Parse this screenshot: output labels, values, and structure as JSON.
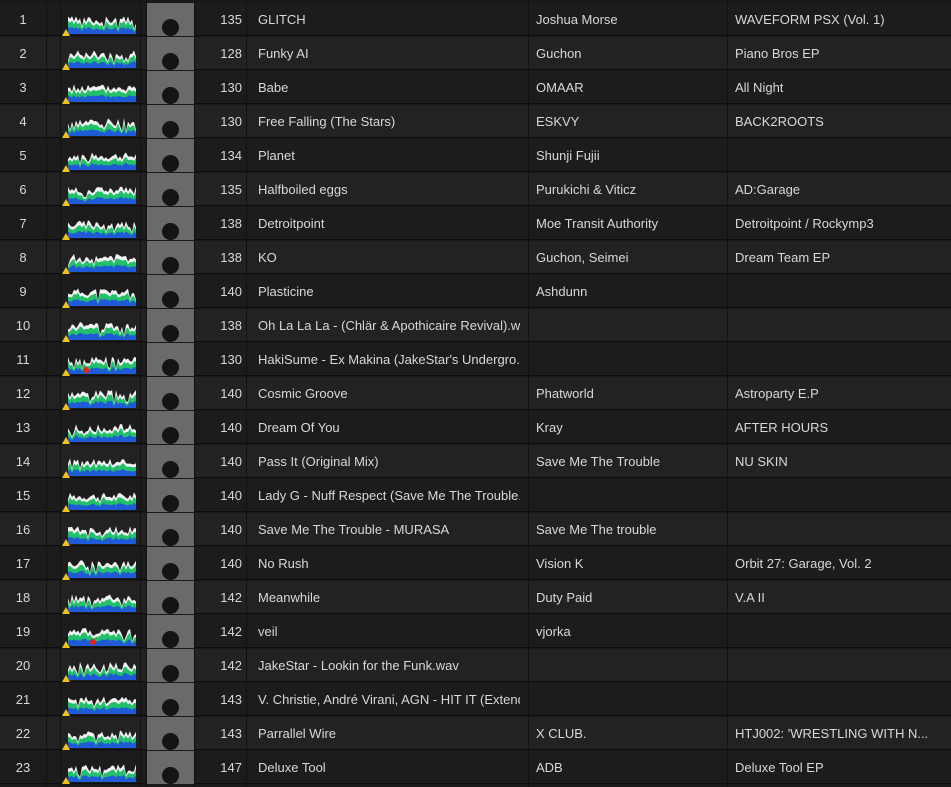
{
  "colors": {
    "waveform_bass": "#1f5bd6",
    "waveform_mid": "#23c06a",
    "waveform_high": "#f2f2f2",
    "cue_marker": "#f1c21a",
    "hot_cue_marker": "#e0261f"
  },
  "tracks": [
    {
      "num": "1",
      "bpm": "135",
      "title": "GLITCH",
      "artist": "Joshua Morse",
      "album": "WAVEFORM PSX (Vol. 1)"
    },
    {
      "num": "2",
      "bpm": "128",
      "title": "Funky AI",
      "artist": "Guchon",
      "album": "Piano Bros EP"
    },
    {
      "num": "3",
      "bpm": "130",
      "title": "Babe",
      "artist": "OMAAR",
      "album": "All Night"
    },
    {
      "num": "4",
      "bpm": "130",
      "title": "Free Falling (The Stars)",
      "artist": "ESKVY",
      "album": "BACK2ROOTS"
    },
    {
      "num": "5",
      "bpm": "134",
      "title": "Planet",
      "artist": "Shunji Fujii",
      "album": ""
    },
    {
      "num": "6",
      "bpm": "135",
      "title": "Halfboiled eggs",
      "artist": "Purukichi & Viticz",
      "album": "AD:Garage"
    },
    {
      "num": "7",
      "bpm": "138",
      "title": "Detroitpoint",
      "artist": "Moe Transit Authority",
      "album": "Detroitpoint / Rockymp3"
    },
    {
      "num": "8",
      "bpm": "138",
      "title": "KO",
      "artist": "Guchon, Seimei",
      "album": "Dream Team EP"
    },
    {
      "num": "9",
      "bpm": "140",
      "title": "Plasticine",
      "artist": "Ashdunn",
      "album": ""
    },
    {
      "num": "10",
      "bpm": "138",
      "title": "Oh La La La - (Chlär & Apothicaire Revival).w...",
      "artist": "",
      "album": ""
    },
    {
      "num": "11",
      "bpm": "130",
      "title": "HakiSume - Ex Makina (JakeStar's Undergro...",
      "artist": "",
      "album": ""
    },
    {
      "num": "12",
      "bpm": "140",
      "title": "Cosmic Groove",
      "artist": "Phatworld",
      "album": "Astroparty E.P"
    },
    {
      "num": "13",
      "bpm": "140",
      "title": "Dream Of You",
      "artist": "Kray",
      "album": "AFTER HOURS"
    },
    {
      "num": "14",
      "bpm": "140",
      "title": "Pass It (Original Mix)",
      "artist": "Save Me The Trouble",
      "album": "NU SKIN"
    },
    {
      "num": "15",
      "bpm": "140",
      "title": "Lady G - Nuff Respect (Save Me The Trouble...",
      "artist": "",
      "album": ""
    },
    {
      "num": "16",
      "bpm": "140",
      "title": "Save Me The Trouble - MURASA",
      "artist": "Save Me The trouble",
      "album": ""
    },
    {
      "num": "17",
      "bpm": "140",
      "title": "No Rush",
      "artist": "Vision K",
      "album": "Orbit 27: Garage, Vol. 2"
    },
    {
      "num": "18",
      "bpm": "142",
      "title": "Meanwhile",
      "artist": "Duty Paid",
      "album": "V.A II"
    },
    {
      "num": "19",
      "bpm": "142",
      "title": "veil",
      "artist": "vjorka",
      "album": ""
    },
    {
      "num": "20",
      "bpm": "142",
      "title": "JakeStar - Lookin for the Funk.wav",
      "artist": "",
      "album": ""
    },
    {
      "num": "21",
      "bpm": "143",
      "title": "V. Christie, André Virani, AGN - HIT IT (Extend...",
      "artist": "",
      "album": ""
    },
    {
      "num": "22",
      "bpm": "143",
      "title": "Parrallel Wire",
      "artist": "X CLUB.",
      "album": "HTJ002: 'WRESTLING WITH N..."
    },
    {
      "num": "23",
      "bpm": "147",
      "title": "Deluxe Tool",
      "artist": "ADB",
      "album": "Deluxe Tool EP"
    }
  ]
}
